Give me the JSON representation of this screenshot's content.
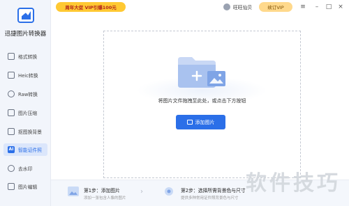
{
  "app": {
    "name": "迅捷图片转换器",
    "promo_text": "周年大促 VIP引爆100元",
    "user_name": "旺旺仙贝",
    "vip_button": "续订VIP",
    "accent_color": "#2b6fe8"
  },
  "sidebar": {
    "items": [
      {
        "label": "格式转换",
        "icon": "format-convert-icon"
      },
      {
        "label": "Heic转换",
        "icon": "heic-icon"
      },
      {
        "label": "Raw转换",
        "icon": "raw-icon"
      },
      {
        "label": "图片压缩",
        "icon": "compress-icon"
      },
      {
        "label": "抠图换背景",
        "icon": "cutout-icon"
      },
      {
        "label": "智能证件照",
        "icon": "ai-id-photo-icon",
        "active": true
      },
      {
        "label": "去水印",
        "icon": "remove-watermark-icon"
      },
      {
        "label": "图片编辑",
        "icon": "image-edit-icon"
      }
    ]
  },
  "window_controls": [
    "menu-icon",
    "minimize-icon",
    "maximize-icon",
    "close-icon"
  ],
  "main": {
    "drop_hint": "将图片文件拖拽至此处，或点击下方按钮",
    "add_button": "添加图片"
  },
  "steps": [
    {
      "title": "第1步：添加图片",
      "sub": "添加一张包含人像的图片"
    },
    {
      "title": "第2步：选择所需背景色与尺寸",
      "sub": "提供多种常用证件照背景色与尺寸"
    }
  ],
  "watermark": "软件技巧"
}
